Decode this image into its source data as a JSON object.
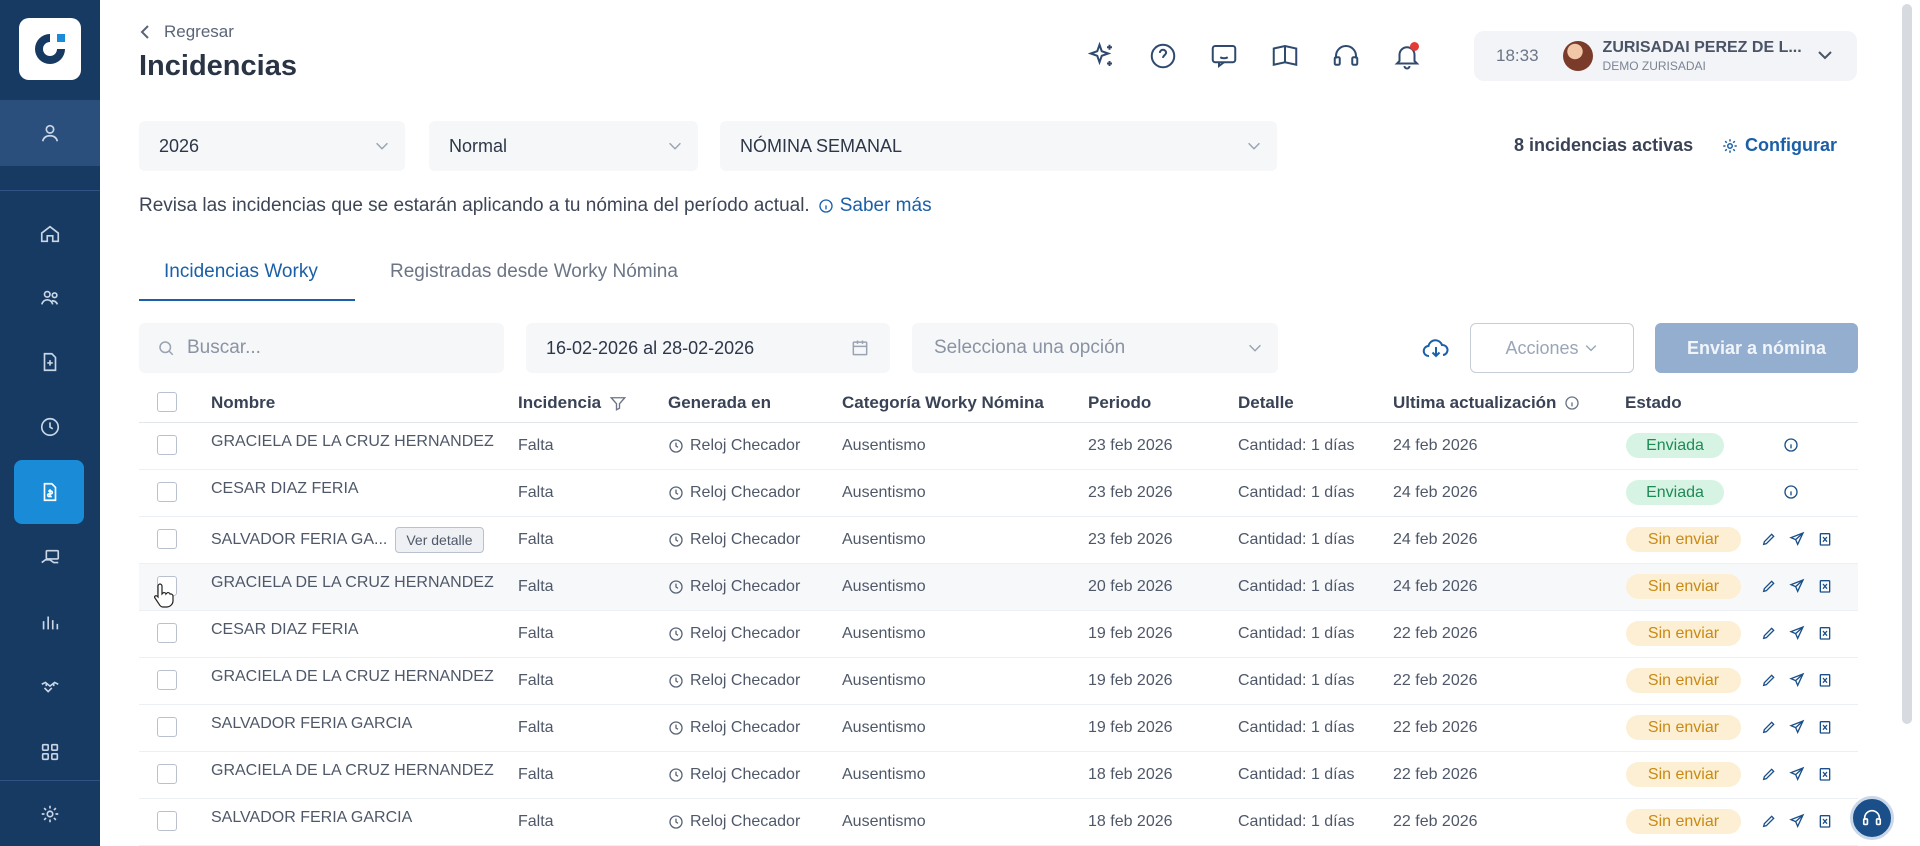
{
  "header": {
    "back_label": "Regresar",
    "title": "Incidencias",
    "time": "18:33",
    "user_name": "ZURISADAI PEREZ DE L...",
    "user_company": "DEMO ZURISADAI"
  },
  "filters": {
    "year": "2026",
    "type": "Normal",
    "payroll": "NÓMINA SEMANAL",
    "active_count": "8 incidencias activas",
    "configure_label": "Configurar"
  },
  "info": {
    "text": "Revisa las incidencias que se estarán aplicando a tu nómina del período actual.",
    "learn_more": "Saber más"
  },
  "tabs": [
    {
      "label": "Incidencias Worky"
    },
    {
      "label": "Registradas desde Worky Nómina"
    }
  ],
  "toolbar": {
    "search_placeholder": "Buscar...",
    "date_range": "16-02-2026 al 28-02-2026",
    "option_placeholder": "Selecciona una opción",
    "actions_label": "Acciones",
    "send_label": "Enviar a nómina"
  },
  "table": {
    "columns": [
      "Nombre",
      "Incidencia",
      "Generada en",
      "Categoría Worky Nómina",
      "Periodo",
      "Detalle",
      "Ultima actualización",
      "Estado"
    ],
    "detail_button": "Ver detalle",
    "rows": [
      {
        "name": "GRACIELA DE LA CRUZ HERNANDEZ",
        "incidence": "Falta",
        "source": "Reloj Checador",
        "category": "Ausentismo",
        "period": "23 feb 2026",
        "detail": "Cantidad: 1 días",
        "updated": "24 feb 2026",
        "status": "Enviada"
      },
      {
        "name": "CESAR DIAZ FERIA",
        "incidence": "Falta",
        "source": "Reloj Checador",
        "category": "Ausentismo",
        "period": "23 feb 2026",
        "detail": "Cantidad: 1 días",
        "updated": "24 feb 2026",
        "status": "Enviada"
      },
      {
        "name": "SALVADOR FERIA GA...",
        "incidence": "Falta",
        "source": "Reloj Checador",
        "category": "Ausentismo",
        "period": "23 feb 2026",
        "detail": "Cantidad: 1 días",
        "updated": "24 feb 2026",
        "status": "Sin enviar"
      },
      {
        "name": "GRACIELA DE LA CRUZ HERNANDEZ",
        "incidence": "Falta",
        "source": "Reloj Checador",
        "category": "Ausentismo",
        "period": "20 feb 2026",
        "detail": "Cantidad: 1 días",
        "updated": "24 feb 2026",
        "status": "Sin enviar"
      },
      {
        "name": "CESAR DIAZ FERIA",
        "incidence": "Falta",
        "source": "Reloj Checador",
        "category": "Ausentismo",
        "period": "19 feb 2026",
        "detail": "Cantidad: 1 días",
        "updated": "22 feb 2026",
        "status": "Sin enviar"
      },
      {
        "name": "GRACIELA DE LA CRUZ HERNANDEZ",
        "incidence": "Falta",
        "source": "Reloj Checador",
        "category": "Ausentismo",
        "period": "19 feb 2026",
        "detail": "Cantidad: 1 días",
        "updated": "22 feb 2026",
        "status": "Sin enviar"
      },
      {
        "name": "SALVADOR FERIA GARCIA",
        "incidence": "Falta",
        "source": "Reloj Checador",
        "category": "Ausentismo",
        "period": "19 feb 2026",
        "detail": "Cantidad: 1 días",
        "updated": "22 feb 2026",
        "status": "Sin enviar"
      },
      {
        "name": "GRACIELA DE LA CRUZ HERNANDEZ",
        "incidence": "Falta",
        "source": "Reloj Checador",
        "category": "Ausentismo",
        "period": "18 feb 2026",
        "detail": "Cantidad: 1 días",
        "updated": "22 feb 2026",
        "status": "Sin enviar"
      },
      {
        "name": "SALVADOR FERIA GARCIA",
        "incidence": "Falta",
        "source": "Reloj Checador",
        "category": "Ausentismo",
        "period": "18 feb 2026",
        "detail": "Cantidad: 1 días",
        "updated": "22 feb 2026",
        "status": "Sin enviar"
      }
    ]
  },
  "icons": {
    "sidebar": [
      "user-icon",
      "home-icon",
      "people-icon",
      "document-add-icon",
      "clock-icon",
      "payroll-icon",
      "hand-money-icon",
      "chart-icon",
      "handshake-icon",
      "apps-grid-icon",
      "settings-icon"
    ],
    "top": [
      "sparkle-icon",
      "help-icon",
      "feedback-icon",
      "book-icon",
      "support-headset-icon",
      "bell-icon"
    ]
  },
  "colors": {
    "sidebar": "#173a63",
    "sidebar_active": "#1a8bd6",
    "primary": "#1a5fa8",
    "sent_bg": "#d6f3e4",
    "sent_text": "#1f8a55",
    "pending_bg": "#fcefd3",
    "pending_text": "#c98a14"
  }
}
